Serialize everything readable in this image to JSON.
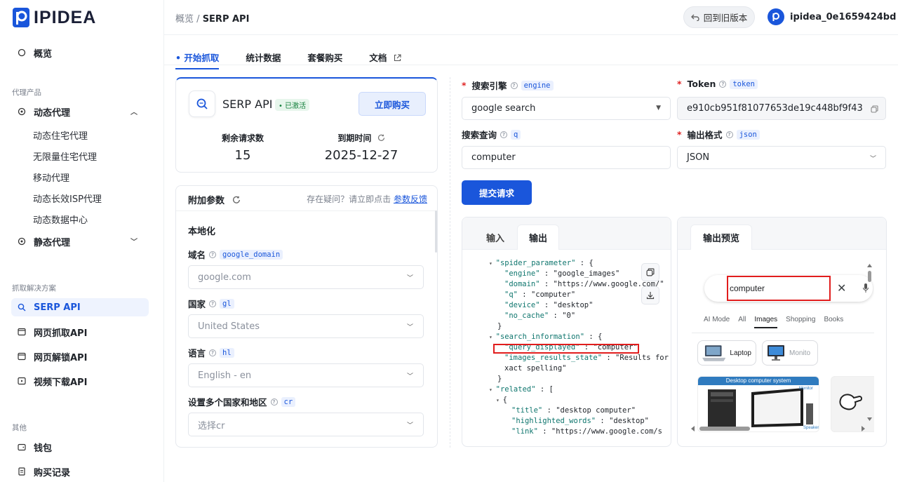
{
  "brand": {
    "name": "IPIDEA",
    "accent": "#1a56db"
  },
  "sidebar": {
    "overview": "概览",
    "group_proxy": "代理产品",
    "dynamic_proxy": "动态代理",
    "dynamic_subs": [
      "动态住宅代理",
      "无限量住宅代理",
      "移动代理",
      "动态长效ISP代理",
      "动态数据中心"
    ],
    "static_proxy": "静态代理",
    "group_scrape": "抓取解决方案",
    "scrape_items": [
      "SERP API",
      "网页抓取API",
      "网页解锁API",
      "视频下载API"
    ],
    "group_other": "其他",
    "other_items": [
      "钱包",
      "购买记录"
    ]
  },
  "topbar": {
    "crumb_root": "概览",
    "crumb_sep": "/",
    "crumb_current": "SERP API",
    "old_version": "回到旧版本",
    "username": "ipidea_0e1659424bd"
  },
  "tabs": [
    "开始抓取",
    "统计数据",
    "套餐购买",
    "文档"
  ],
  "serp_card": {
    "title": "SERP API",
    "status": "已激活",
    "buy_now": "立即购买",
    "remaining_label": "剩余请求数",
    "remaining_value": "15",
    "expiry_label": "到期时间",
    "expiry_value": "2025-12-27"
  },
  "params": {
    "title": "附加参数",
    "help_text": "存在疑问？请立即点击",
    "help_link": "参数反馈",
    "localization": "本地化",
    "fields": [
      {
        "label": "域名",
        "tag": "google_domain",
        "value": "google.com"
      },
      {
        "label": "国家",
        "tag": "gl",
        "value": "United States"
      },
      {
        "label": "语言",
        "tag": "hl",
        "value": "English - en"
      },
      {
        "label": "设置多个国家和地区",
        "tag": "cr",
        "value": "选择cr"
      }
    ]
  },
  "form": {
    "engine_label": "搜索引擎",
    "engine_tag": "engine",
    "engine_value": "google search",
    "token_label": "Token",
    "token_tag": "token",
    "token_value": "e910cb951f81077653de19c448bf9f43",
    "query_label": "搜索查询",
    "query_tag": "q",
    "query_value": "computer",
    "format_label": "输出格式",
    "format_tag": "json",
    "format_value": "JSON",
    "submit": "提交请求"
  },
  "output": {
    "tab_input": "输入",
    "tab_output": "输出",
    "json_lines": [
      {
        "indent": 0,
        "toggle": true,
        "key": "\"spider_parameter\"",
        "sep": " : ",
        "val": "{"
      },
      {
        "indent": 1,
        "key": "\"engine\"",
        "sep": " : ",
        "val": "\"google_images\""
      },
      {
        "indent": 1,
        "key": "\"domain\"",
        "sep": " : ",
        "val": "\"https://www.google.com/\""
      },
      {
        "indent": 1,
        "key": "\"q\"",
        "sep": " : ",
        "val": "\"computer\""
      },
      {
        "indent": 1,
        "key": "\"device\"",
        "sep": " : ",
        "val": "\"desktop\""
      },
      {
        "indent": 1,
        "key": "\"no_cache\"",
        "sep": " : ",
        "val": "\"0\""
      },
      {
        "indent": 0,
        "key": "",
        "sep": "",
        "val": "}"
      },
      {
        "indent": 0,
        "toggle": true,
        "key": "\"search_information\"",
        "sep": " : ",
        "val": "{"
      },
      {
        "indent": 1,
        "key": "\"query_displayed\"",
        "sep": " : ",
        "val": "\"computer\""
      },
      {
        "indent": 1,
        "key": "\"images_results_state\"",
        "sep": " : ",
        "val": "\"Results for e"
      },
      {
        "indent": 1,
        "key": "",
        "sep": "",
        "val": "xact spelling\""
      },
      {
        "indent": 0,
        "key": "",
        "sep": "",
        "val": "}"
      },
      {
        "indent": 0,
        "toggle": true,
        "key": "\"related\"",
        "sep": " : ",
        "val": "["
      },
      {
        "indent": 1,
        "toggle": true,
        "key": "",
        "sep": "",
        "val": "{"
      },
      {
        "indent": 2,
        "key": "\"title\"",
        "sep": " : ",
        "val": "\"desktop computer\""
      },
      {
        "indent": 2,
        "key": "\"highlighted_words\"",
        "sep": " : ",
        "val": "\"desktop\""
      },
      {
        "indent": 2,
        "key": "\"link\"",
        "sep": " : ",
        "val": "\"https://www.google.com/s"
      }
    ]
  },
  "preview": {
    "tab": "输出预览",
    "query": "computer",
    "g_tabs": [
      "AI Mode",
      "All",
      "Images",
      "Shopping",
      "Books"
    ],
    "chips": [
      "Laptop",
      "Monito"
    ],
    "tile_caption": "Desktop computer system",
    "tile_labels": [
      "Monitor",
      "Speaker"
    ]
  }
}
